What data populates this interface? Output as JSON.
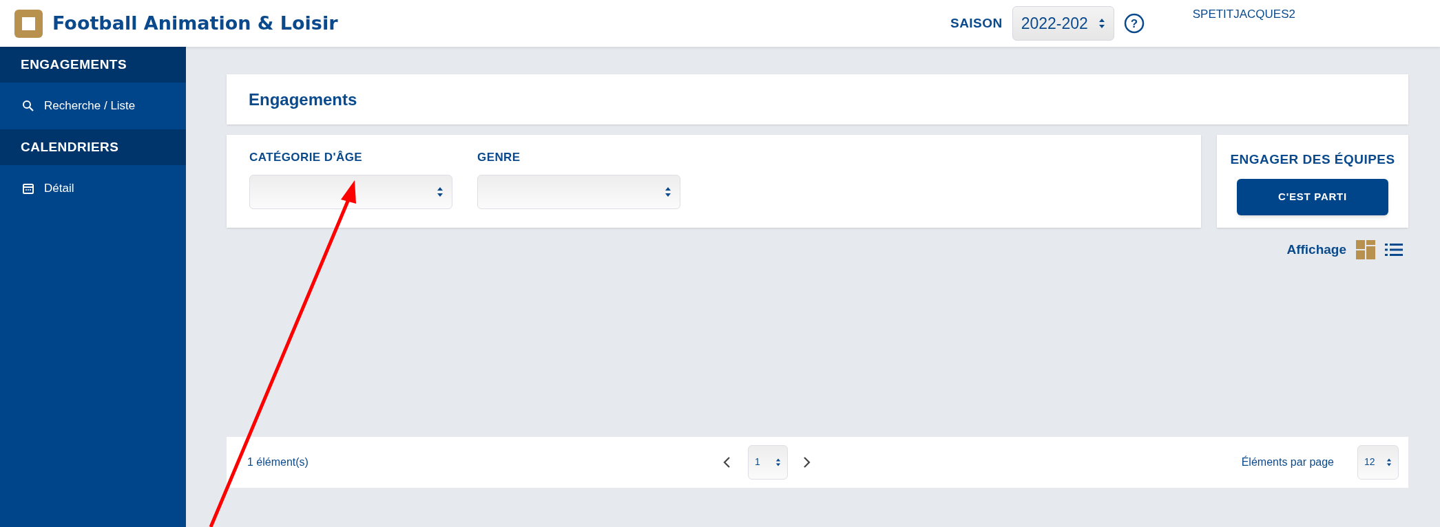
{
  "header": {
    "title": "Football Animation & Loisir",
    "season_label": "SAISON",
    "season_value": "2022-202",
    "user": "SPETITJACQUES2",
    "help": "?"
  },
  "sidebar": {
    "sections": [
      {
        "title": "ENGAGEMENTS",
        "items": [
          {
            "label": "Recherche / Liste",
            "kind": "search"
          }
        ]
      },
      {
        "title": "CALENDRIERS",
        "items": [
          {
            "label": "Détail",
            "kind": "calendar"
          }
        ]
      }
    ]
  },
  "page_title": "Engagements",
  "filters": [
    {
      "label": "CATÉGORIE D'ÂGE"
    },
    {
      "label": "GENRE"
    }
  ],
  "engage": {
    "title": "ENGAGER DES ÉQUIPES",
    "button": "C'EST PARTI"
  },
  "display": {
    "label": "Affichage",
    "views": [
      {
        "kind": "grid",
        "selected": true
      },
      {
        "kind": "list",
        "selected": false
      }
    ]
  },
  "pagination": {
    "count": "1 élément(s)",
    "page": "1",
    "per_page_label": "Éléments par page",
    "per_page": "12"
  }
}
